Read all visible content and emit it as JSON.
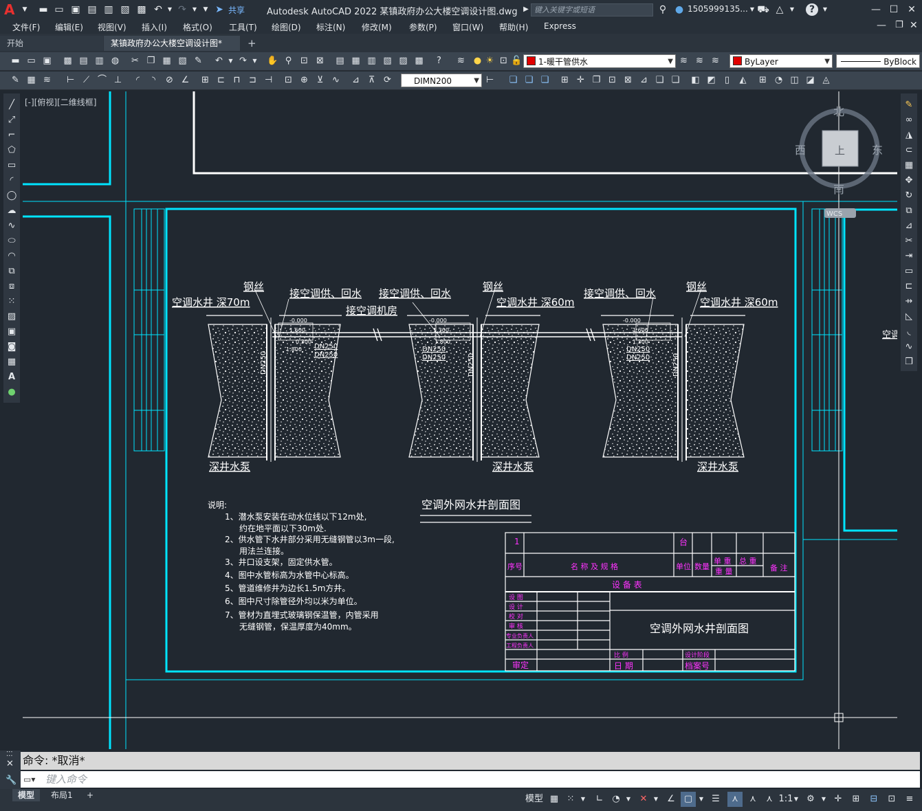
{
  "titlebar": {
    "logo": "A",
    "share_label": "共享",
    "app_title": "Autodesk AutoCAD 2022    某镇政府办公大楼空调设计图.dwg",
    "search_placeholder": "键入关键字或短语",
    "user_name": "1505999135...",
    "help": "?"
  },
  "menus": [
    "文件(F)",
    "编辑(E)",
    "视图(V)",
    "插入(I)",
    "格式(O)",
    "工具(T)",
    "绘图(D)",
    "标注(N)",
    "修改(M)",
    "参数(P)",
    "窗口(W)",
    "帮助(H)",
    "Express"
  ],
  "tabs": {
    "start": "开始",
    "doc": "某镇政府办公大楼空调设计图*",
    "add": "+"
  },
  "toolbar": {
    "layer_value": "1-暖干管供水",
    "color_value": "ByLayer",
    "linetype_value": "ByBlock",
    "dimstyle_value": "DIMN200",
    "layer_color": "#e00000"
  },
  "view_label": "[-][俯视][二维线框]",
  "viewcube": {
    "north": "北",
    "south": "南",
    "east": "东",
    "west": "西",
    "top": "上",
    "wcs": "WCS"
  },
  "drawing": {
    "wells": [
      {
        "name": "空调水井  深70m",
        "wire": "钢丝",
        "pump": "深井水泵",
        "pipe": "DN250"
      },
      {
        "name": "空调水井  深60m",
        "wire": "钢丝",
        "pump": "深井水泵",
        "pipe": "DN250"
      },
      {
        "name": "空调水井  深60m",
        "wire": "钢丝",
        "pump": "深井水泵",
        "pipe": "DN250"
      }
    ],
    "supply_label": "接空调供、回水",
    "room_label": "接空调机房",
    "section_title": "空调外网水井剖面图",
    "right_cut_text": "空调",
    "notes_title": "说明:",
    "notes": [
      "1、潜水泵安装在动水位线以下12m处,",
      "约在地平面以下30m处.",
      "2、供水管下水井部分采用无缝钢管以3m一段,",
      "用法兰连接。",
      "3、井口设支架，固定供水管。",
      "4、图中水管标高为水管中心标高。",
      "5、管道维修井为边长1.5m方井。",
      "6、图中尺寸除管径外均以米为单位。",
      "7、管材为直埋式玻璃钢保温管，内管采用",
      "无缝钢管，保温厚度为40mm。"
    ],
    "table": {
      "row1_num": "1",
      "row1_unit": "台",
      "hdr_num": "序号",
      "hdr_name": "名 称 及 规 格",
      "hdr_unit": "单位",
      "hdr_qty": "数量",
      "hdr_unitw": "单 重",
      "hdr_totalw": "总 重",
      "hdr_weight": "重 量",
      "hdr_note": "备 注",
      "equip_title": "设    备    表",
      "roles": [
        "设 图",
        "设 计",
        "校 对",
        "审 核",
        "专业负责人",
        "工程负责人"
      ],
      "review": "审定",
      "scale": "比 例",
      "date": "日 期",
      "stage": "设计阶段",
      "archive": "档案号",
      "drawing_name": "空调外网水井剖面图"
    }
  },
  "command": {
    "history": "命令: *取消*",
    "placeholder": "键入命令"
  },
  "status": {
    "model_tab": "模型",
    "layout_tab": "布局1",
    "add_tab": "+",
    "model_label": "模型",
    "scale": "1:1"
  }
}
